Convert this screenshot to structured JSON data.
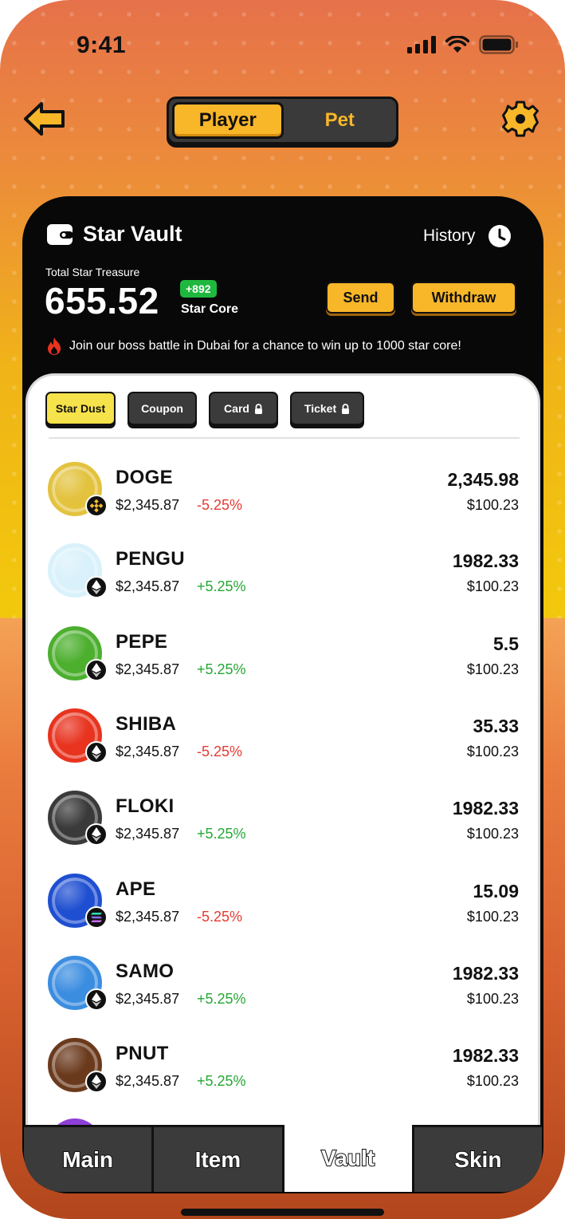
{
  "status_bar": {
    "time": "9:41"
  },
  "header": {
    "segment": {
      "active": "Player",
      "inactive": "Pet"
    }
  },
  "vault": {
    "title": "Star Vault",
    "history_label": "History",
    "total_label": "Total Star Treasure",
    "total_value": "655.52",
    "delta": "+892",
    "unit": "Star Core",
    "send_label": "Send",
    "withdraw_label": "Withdraw",
    "promo": "Join our boss battle in Dubai for a chance to win up to 1000 star core!"
  },
  "tabs": [
    {
      "label": "Star Dust",
      "locked": false,
      "active": true
    },
    {
      "label": "Coupon",
      "locked": false,
      "active": false
    },
    {
      "label": "Card",
      "locked": true,
      "active": false
    },
    {
      "label": "Ticket",
      "locked": true,
      "active": false
    }
  ],
  "assets": [
    {
      "symbol": "DOGE",
      "price": "$2,345.87",
      "change": "-5.25%",
      "direction": "neg",
      "amount": "2,345.98",
      "value": "$100.23",
      "chain": "bnb-icon",
      "coin_color": "#e3c23e"
    },
    {
      "symbol": "PENGU",
      "price": "$2,345.87",
      "change": "+5.25%",
      "direction": "pos",
      "amount": "1982.33",
      "value": "$100.23",
      "chain": "eth-icon",
      "coin_color": "#d9f1fb"
    },
    {
      "symbol": "PEPE",
      "price": "$2,345.87",
      "change": "+5.25%",
      "direction": "pos",
      "amount": "5.5",
      "value": "$100.23",
      "chain": "eth-icon",
      "coin_color": "#4caf2e"
    },
    {
      "symbol": "SHIBA",
      "price": "$2,345.87",
      "change": "-5.25%",
      "direction": "neg",
      "amount": "35.33",
      "value": "$100.23",
      "chain": "eth-icon",
      "coin_color": "#e8331f"
    },
    {
      "symbol": "FLOKI",
      "price": "$2,345.87",
      "change": "+5.25%",
      "direction": "pos",
      "amount": "1982.33",
      "value": "$100.23",
      "chain": "eth-icon",
      "coin_color": "#3a3a3a"
    },
    {
      "symbol": "APE",
      "price": "$2,345.87",
      "change": "-5.25%",
      "direction": "neg",
      "amount": "15.09",
      "value": "$100.23",
      "chain": "sol-icon",
      "coin_color": "#1f4fd1"
    },
    {
      "symbol": "SAMO",
      "price": "$2,345.87",
      "change": "+5.25%",
      "direction": "pos",
      "amount": "1982.33",
      "value": "$100.23",
      "chain": "eth-icon",
      "coin_color": "#3b8de0"
    },
    {
      "symbol": "PNUT",
      "price": "$2,345.87",
      "change": "+5.25%",
      "direction": "pos",
      "amount": "1982.33",
      "value": "$100.23",
      "chain": "eth-icon",
      "coin_color": "#6b3a1d"
    }
  ],
  "nav": [
    {
      "label": "Main",
      "active": false
    },
    {
      "label": "Item",
      "active": false
    },
    {
      "label": "Vault",
      "active": true
    },
    {
      "label": "Skin",
      "active": false
    }
  ]
}
